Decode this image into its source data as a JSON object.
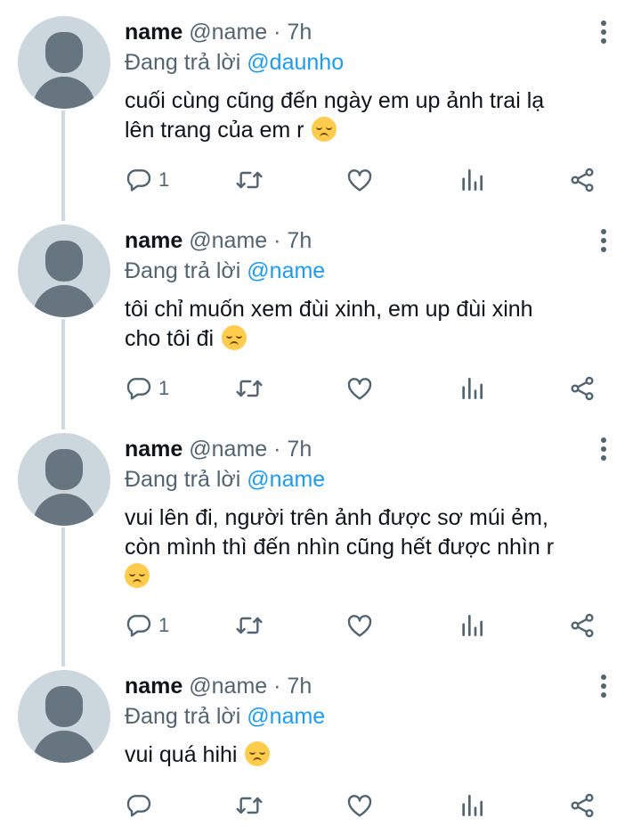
{
  "tweets": [
    {
      "author_name": "name",
      "handle": "@name",
      "separator": "·",
      "time": "7h",
      "replying_prefix": "Đang trả lời",
      "replying_to": "@daunho",
      "text_lines": [
        "cuối cùng cũng đến ngày em up ảnh trai lạ",
        "lên trang của em r"
      ],
      "emoji": "disappointed-face",
      "reply_count": "1"
    },
    {
      "author_name": "name",
      "handle": "@name",
      "separator": "·",
      "time": "7h",
      "replying_prefix": "Đang trả lời",
      "replying_to": "@name",
      "text_lines": [
        "tôi chỉ muốn xem đùi xinh, em up đùi xinh",
        "cho tôi đi"
      ],
      "emoji": "disappointed-face",
      "reply_count": "1"
    },
    {
      "author_name": "name",
      "handle": "@name",
      "separator": "·",
      "time": "7h",
      "replying_prefix": "Đang trả lời",
      "replying_to": "@name",
      "text_lines": [
        "vui lên đi, người trên ảnh được sơ múi ẻm,",
        "còn mình thì đến nhìn cũng hết được nhìn r"
      ],
      "emoji": "disappointed-face",
      "reply_count": "1"
    },
    {
      "author_name": "name",
      "handle": "@name",
      "separator": "·",
      "time": "7h",
      "replying_prefix": "Đang trả lời",
      "replying_to": "@name",
      "text_lines": [
        "vui quá hihi"
      ],
      "emoji": "disappointed-face",
      "reply_count": ""
    }
  ],
  "icons": {
    "reply": "reply-icon",
    "retweet": "retweet-icon",
    "like": "heart-icon",
    "analytics": "analytics-icon",
    "share": "share-icon",
    "more": "more-vertical-icon"
  },
  "colors": {
    "mention": "#1d9bf0",
    "secondary_text": "#536471",
    "thread_line": "#cfd9de",
    "avatar_bg": "#ccd6dd"
  }
}
